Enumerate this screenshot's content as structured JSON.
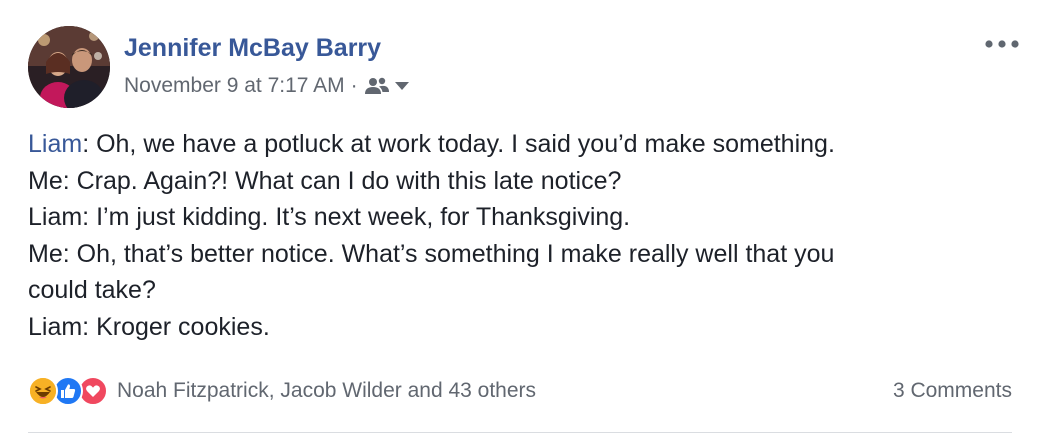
{
  "post": {
    "author": "Jennifer McBay Barry",
    "timestamp": "November 9 at 7:17 AM",
    "separator": "·",
    "audience_icon": "friends-icon",
    "more_icon": "more-options-icon",
    "lines": {
      "l1_name": "Liam",
      "l1_text": ": Oh, we have a potluck at work today. I said you’d make something.",
      "l2": "Me: Crap. Again?! What can I do with this late notice?",
      "l3": "Liam: I’m just kidding. It’s next week, for Thanksgiving.",
      "l4": "Me: Oh, that’s better notice. What’s something I make really well that you",
      "l5": "could take?",
      "l6": "Liam: Kroger cookies."
    }
  },
  "reactions": {
    "icons": [
      "haha-icon",
      "like-icon",
      "love-icon"
    ],
    "colors": {
      "haha": "#f7b125",
      "like": "#2078f4",
      "love": "#f0485f"
    },
    "summary": "Noah Fitzpatrick, Jacob Wilder and 43 others",
    "comments": "3 Comments"
  },
  "colors": {
    "link": "#385898",
    "meta": "#616770",
    "text": "#1d2129"
  }
}
